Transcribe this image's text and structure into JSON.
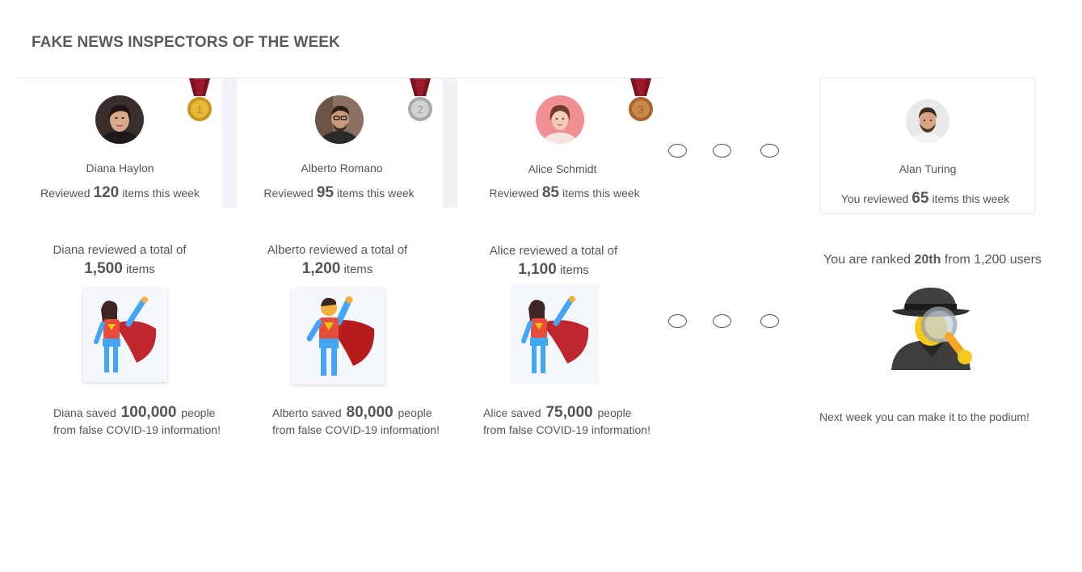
{
  "header": {
    "title": "FAKE NEWS INSPECTORS OF THE WEEK"
  },
  "podium": [
    {
      "name": "Diana Haylon",
      "reviewed_prefix": "Reviewed",
      "reviewed_count": "120",
      "reviewed_suffix": "items this week",
      "total_line": "Diana reviewed a total of",
      "total_count": "1,500",
      "total_unit": "items",
      "saved_prefix": "Diana saved",
      "saved_count": "100,000",
      "saved_suffix": "people",
      "saved_line2": "from false COVID-19 information!",
      "medal": "gold-medal-icon",
      "medal_number": "1",
      "hero": "superwoman-icon"
    },
    {
      "name": "Alberto Romano",
      "reviewed_prefix": "Reviewed",
      "reviewed_count": "95",
      "reviewed_suffix": "items this week",
      "total_line": "Alberto reviewed a total of",
      "total_count": "1,200",
      "total_unit": "items",
      "saved_prefix": "Alberto saved",
      "saved_count": "80,000",
      "saved_suffix": "people",
      "saved_line2": "from false COVID-19 information!",
      "medal": "silver-medal-icon",
      "medal_number": "2",
      "hero": "superman-icon"
    },
    {
      "name": "Alice Schmidt",
      "reviewed_prefix": "Reviewed",
      "reviewed_count": "85",
      "reviewed_suffix": "items this week",
      "total_line": "Alice reviewed a total of",
      "total_count": "1,100",
      "total_unit": "items",
      "saved_prefix": "Alice saved",
      "saved_count": "75,000",
      "saved_suffix": "people",
      "saved_line2": "from false COVID-19 information!",
      "medal": "bronze-medal-icon",
      "medal_number": "3",
      "hero": "superwoman-icon"
    }
  ],
  "current_user": {
    "name": "Alan Turing",
    "reviewed_prefix": "You reviewed",
    "reviewed_count": "65",
    "reviewed_suffix": "items this week",
    "rank_prefix": "You are ranked",
    "rank": "20th",
    "rank_suffix": "from 1,200 users",
    "encouragement": "Next week you can make it to the podium!",
    "icon": "detective-icon"
  },
  "colors": {
    "gold": "#d4a017",
    "silver": "#b8b8b8",
    "bronze": "#b8733a",
    "ribbon": "#7a1020",
    "cape": "#c0262d",
    "suit_blue": "#42a5f5"
  }
}
